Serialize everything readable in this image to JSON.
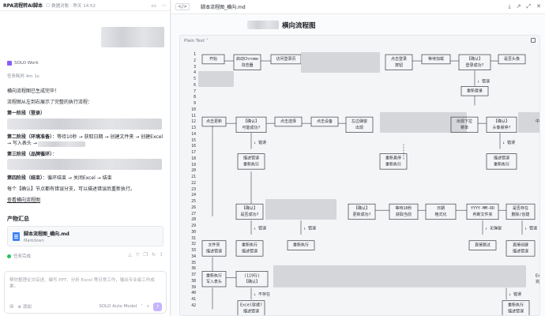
{
  "left": {
    "title": "RPA流程转AI脚本",
    "meta": "数据对账 · 昨天 14:52",
    "agent_tag": "SOLO Work",
    "elapsed": "任务耗时 4m 1s",
    "msg": {
      "done": "横向流程图已生成完毕！",
      "intro": "流程图从左到右展示了完整的执行流程：",
      "p1_title": "第一阶段（登录）",
      "p2_title": "第二阶段（环境准备）",
      "p2_text": "：等待10秒 → 获取日期 → 创建文件夹 → 创建Excel → 写入表头 →",
      "p3_title": "第三阶段（品牌循环）",
      "p3_colon": "：",
      "p4_title": "第四阶段（结束）",
      "p4_text": "：循环结束 → 关闭Excel → 结束",
      "note": "每个【确认】节点都有错误分支，可以描述错误后重新执行。",
      "link": "查看横向流程图"
    },
    "artifacts_title": "产物汇总",
    "file": {
      "name": "脚本流程图_横向.md",
      "type": "Markdown"
    },
    "task_status": "任务完成",
    "composer": {
      "placeholder": "帮你整理论文综述、编写 PPT、分析 Excel 等日常工作，输出专业级工作成果。",
      "mode": "SOLO Auto Model",
      "attach": "@",
      "web": "⊕ 添加"
    }
  },
  "right": {
    "code_toggle": "</>",
    "tab": "脚本流程图_横向.md",
    "doc_title": "横向流程图",
    "lang": "Plain Text ˅",
    "line_numbers": [
      "1",
      "2",
      "3",
      "4",
      "5",
      "6",
      "7",
      "8",
      "9",
      "10",
      "11",
      "12",
      "13",
      "14",
      "15",
      "16",
      "17",
      "18",
      "19",
      "20",
      "21",
      "22",
      "23",
      "24",
      "25",
      "26",
      "27",
      "28",
      "29",
      "30",
      "31",
      "32",
      "33",
      "34",
      "35",
      "36",
      "37",
      "38",
      "39",
      "40",
      "41",
      "42"
    ],
    "nodes": [
      {
        "row": 0,
        "text": "开始"
      },
      {
        "row": 0,
        "text": "启动Chrome"
      },
      {
        "row": 0,
        "text": "浏览器"
      },
      {
        "row": 0,
        "text": "访问登录页"
      },
      {
        "row": 0,
        "text": "点击登录"
      },
      {
        "row": 0,
        "text": "按钮"
      },
      {
        "row": 0,
        "text": "等待加载"
      },
      {
        "row": 0,
        "text": "【确认】"
      },
      {
        "row": 0,
        "text": "登录成功?"
      },
      {
        "row": 0,
        "text": "是否头像"
      },
      {
        "row": 1,
        "text": "重新登录"
      },
      {
        "row": 2,
        "text": "点击更新"
      },
      {
        "row": 2,
        "text": "【确认】"
      },
      {
        "row": 2,
        "text": "可能成功?"
      },
      {
        "row": 2,
        "text": "点击选择"
      },
      {
        "row": 2,
        "text": "点击设备"
      },
      {
        "row": 2,
        "text": "左边弹窗"
      },
      {
        "row": 2,
        "text": "出现"
      },
      {
        "row": 2,
        "text": "出现下拉"
      },
      {
        "row": 2,
        "text": "菜单"
      },
      {
        "row": 2,
        "text": "【确认】"
      },
      {
        "row": 2,
        "text": "头像悬停?"
      },
      {
        "row": 3,
        "text": "描述错误"
      },
      {
        "row": 3,
        "text": "重新执行"
      },
      {
        "row": 3,
        "text": "描述错误"
      },
      {
        "row": 3,
        "text": "重新执行"
      },
      {
        "row": 3,
        "text": "重新悬停"
      },
      {
        "row": 3,
        "text": "重新执行"
      },
      {
        "row": 4,
        "text": "【确认】"
      },
      {
        "row": 4,
        "text": "是否成功?"
      },
      {
        "row": 4,
        "text": "【确认】"
      },
      {
        "row": 4,
        "text": "更新成功?"
      },
      {
        "row": 4,
        "text": "等待10秒"
      },
      {
        "row": 4,
        "text": "获取当前"
      },
      {
        "row": 4,
        "text": "日期"
      },
      {
        "row": 4,
        "text": "格式化"
      },
      {
        "row": 4,
        "text": "YYYY-MM-DD"
      },
      {
        "row": 4,
        "text": "判断文件夹"
      },
      {
        "row": 4,
        "text": "是否存在"
      },
      {
        "row": 4,
        "text": "删除/创建"
      },
      {
        "row": 4,
        "text": "文件夹"
      },
      {
        "row": 5,
        "text": "描述错误"
      },
      {
        "row": 5,
        "text": "重新执行"
      },
      {
        "row": 5,
        "text": "描述错误"
      },
      {
        "row": 5,
        "text": "重新执行"
      },
      {
        "row": 5,
        "text": "直接跳过"
      },
      {
        "row": 5,
        "text": "直接创建"
      },
      {
        "row": 5,
        "text": "描述错误"
      },
      {
        "row": 5,
        "text": "重新执行"
      },
      {
        "row": 6,
        "text": "写入表头"
      },
      {
        "row": 6,
        "text": "(119行)"
      },
      {
        "row": 6,
        "text": "【确认】"
      },
      {
        "row": 6,
        "text": "Excel就绪?"
      },
      {
        "row": 7,
        "text": "描述错误"
      },
      {
        "row": 7,
        "text": "重新执行"
      },
      {
        "row": 7,
        "text": "描述错误"
      },
      {
        "row": 7,
        "text": "重新执行"
      }
    ],
    "edge_labels": [
      "↓ 错误",
      "↓ 错误",
      "↓ 错误",
      "↓ 错误",
      "↓ 错误",
      "↓ 无弹窗",
      "↓ 错误",
      "↓ 不存在",
      "↓ 错误",
      "↓ 错误",
      "↓ 错误"
    ],
    "partial": [
      "中心",
      "Excel",
      "完成"
    ]
  }
}
